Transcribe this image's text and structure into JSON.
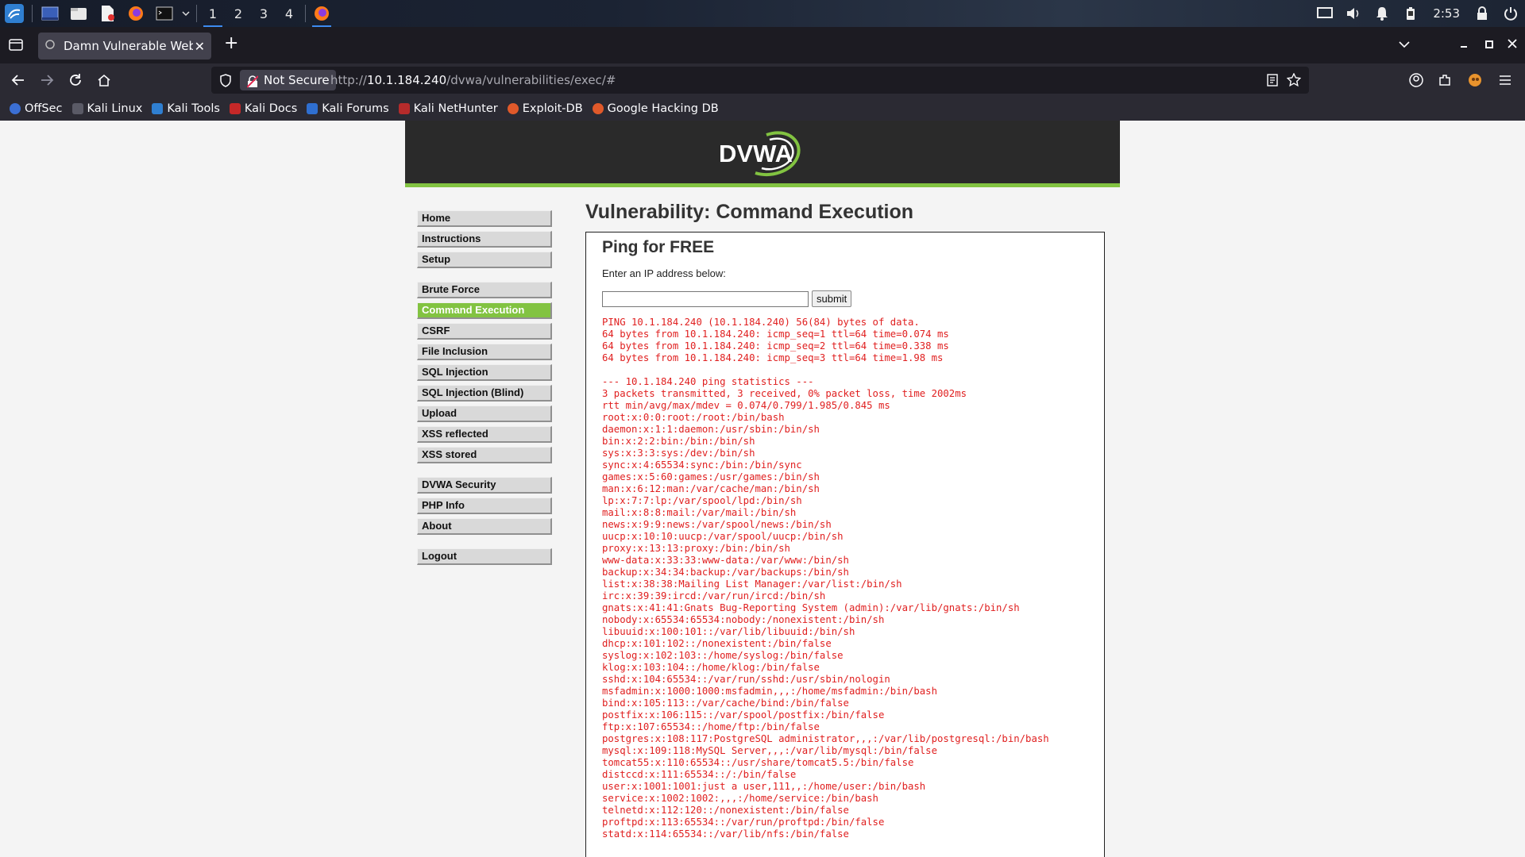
{
  "taskbar": {
    "workspaces": [
      "1",
      "2",
      "3",
      "4"
    ],
    "clock": "2:53"
  },
  "browser": {
    "tab_title": "Damn Vulnerable Web Ap",
    "security_label": "Not Secure",
    "url_prefix": "http://",
    "url_host": "10.1.184.240",
    "url_path": "/dvwa/vulnerabilities/exec/#",
    "bookmarks": [
      "OffSec",
      "Kali Linux",
      "Kali Tools",
      "Kali Docs",
      "Kali Forums",
      "Kali NetHunter",
      "Exploit-DB",
      "Google Hacking DB"
    ]
  },
  "dvwa": {
    "logo_text": "DVWA",
    "menu": {
      "group1": [
        "Home",
        "Instructions",
        "Setup"
      ],
      "group2": [
        "Brute Force",
        "Command Execution",
        "CSRF",
        "File Inclusion",
        "SQL Injection",
        "SQL Injection (Blind)",
        "Upload",
        "XSS reflected",
        "XSS stored"
      ],
      "group3": [
        "DVWA Security",
        "PHP Info",
        "About"
      ],
      "group4": [
        "Logout"
      ]
    },
    "selected_menu": "Command Execution",
    "page_title": "Vulnerability: Command Execution",
    "box_title": "Ping for FREE",
    "prompt": "Enter an IP address below:",
    "ip_value": "",
    "submit_label": "submit",
    "output": "PING 10.1.184.240 (10.1.184.240) 56(84) bytes of data.\n64 bytes from 10.1.184.240: icmp_seq=1 ttl=64 time=0.074 ms\n64 bytes from 10.1.184.240: icmp_seq=2 ttl=64 time=0.338 ms\n64 bytes from 10.1.184.240: icmp_seq=3 ttl=64 time=1.98 ms\n\n--- 10.1.184.240 ping statistics ---\n3 packets transmitted, 3 received, 0% packet loss, time 2002ms\nrtt min/avg/max/mdev = 0.074/0.799/1.985/0.845 ms\nroot:x:0:0:root:/root:/bin/bash\ndaemon:x:1:1:daemon:/usr/sbin:/bin/sh\nbin:x:2:2:bin:/bin:/bin/sh\nsys:x:3:3:sys:/dev:/bin/sh\nsync:x:4:65534:sync:/bin:/bin/sync\ngames:x:5:60:games:/usr/games:/bin/sh\nman:x:6:12:man:/var/cache/man:/bin/sh\nlp:x:7:7:lp:/var/spool/lpd:/bin/sh\nmail:x:8:8:mail:/var/mail:/bin/sh\nnews:x:9:9:news:/var/spool/news:/bin/sh\nuucp:x:10:10:uucp:/var/spool/uucp:/bin/sh\nproxy:x:13:13:proxy:/bin:/bin/sh\nwww-data:x:33:33:www-data:/var/www:/bin/sh\nbackup:x:34:34:backup:/var/backups:/bin/sh\nlist:x:38:38:Mailing List Manager:/var/list:/bin/sh\nirc:x:39:39:ircd:/var/run/ircd:/bin/sh\ngnats:x:41:41:Gnats Bug-Reporting System (admin):/var/lib/gnats:/bin/sh\nnobody:x:65534:65534:nobody:/nonexistent:/bin/sh\nlibuuid:x:100:101::/var/lib/libuuid:/bin/sh\ndhcp:x:101:102::/nonexistent:/bin/false\nsyslog:x:102:103::/home/syslog:/bin/false\nklog:x:103:104::/home/klog:/bin/false\nsshd:x:104:65534::/var/run/sshd:/usr/sbin/nologin\nmsfadmin:x:1000:1000:msfadmin,,,:/home/msfadmin:/bin/bash\nbind:x:105:113::/var/cache/bind:/bin/false\npostfix:x:106:115::/var/spool/postfix:/bin/false\nftp:x:107:65534::/home/ftp:/bin/false\npostgres:x:108:117:PostgreSQL administrator,,,:/var/lib/postgresql:/bin/bash\nmysql:x:109:118:MySQL Server,,,:/var/lib/mysql:/bin/false\ntomcat55:x:110:65534::/usr/share/tomcat5.5:/bin/false\ndistccd:x:111:65534::/:/bin/false\nuser:x:1001:1001:just a user,111,,:/home/user:/bin/bash\nservice:x:1002:1002:,,,:/home/service:/bin/bash\ntelnetd:x:112:120::/nonexistent:/bin/false\nproftpd:x:113:65534::/var/run/proftpd:/bin/false\nstatd:x:114:65534::/var/lib/nfs:/bin/false"
  }
}
